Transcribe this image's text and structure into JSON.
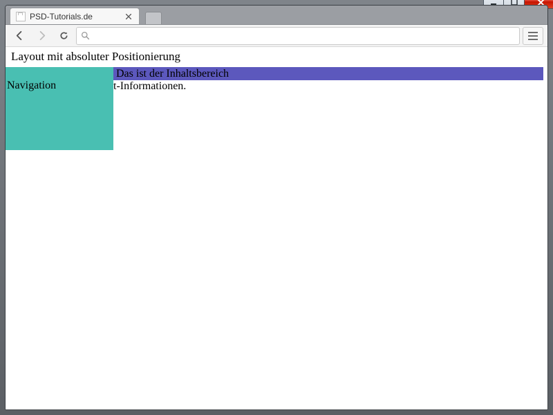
{
  "window": {
    "minimize_label": "Minimize",
    "maximize_label": "Maximize",
    "close_label": "Close"
  },
  "browser": {
    "tab": {
      "title": "PSD-Tutorials.de"
    },
    "omnibox_value": "",
    "omnibox_placeholder": ""
  },
  "page": {
    "heading": "Layout mit absoluter Positionierung",
    "navigation_label": "Navigation",
    "content_heading": "Das ist der Inhaltsbereich",
    "info_text": "t-Informationen."
  }
}
